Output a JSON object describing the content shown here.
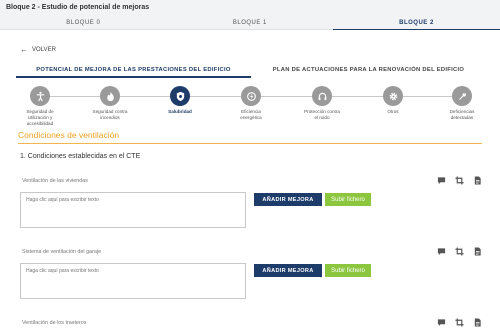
{
  "header": {
    "title": "Bloque 2 - Estudio de potencial de mejoras",
    "bloques": [
      "BLOQUE 0",
      "BLOQUE 1",
      "BLOQUE 2"
    ]
  },
  "back_label": "VOLVER",
  "section_tabs": [
    "POTENCIAL DE MEJORA DE LAS PRESTACIONES DEL EDIFICIO",
    "PLAN DE ACTUACIONES PARA LA RENOVACIÓN DEL EDIFICIO"
  ],
  "categories": [
    {
      "label_1": "Seguridad de",
      "label_2": "Utilización y",
      "label_3": "accesibilidad",
      "icon": "accessibility-icon"
    },
    {
      "label_1": "Seguridad contra",
      "label_2": "incendios",
      "label_3": "",
      "icon": "fire-icon"
    },
    {
      "label_1": "Salubridad",
      "label_2": "",
      "label_3": "",
      "icon": "shield-icon"
    },
    {
      "label_1": "Eficiencia",
      "label_2": "energética",
      "label_3": "",
      "icon": "energy-icon"
    },
    {
      "label_1": "Protección contra",
      "label_2": "el ruido",
      "label_3": "",
      "icon": "headphones-icon"
    },
    {
      "label_1": "Otros",
      "label_2": "",
      "label_3": "",
      "icon": "gear-icon"
    },
    {
      "label_1": "Deficiencias",
      "label_2": "detectadas",
      "label_3": "",
      "icon": "wrench-icon"
    }
  ],
  "colors": {
    "primary": "#1d3c6a",
    "accent": "#f0a024",
    "success": "#8cc63f"
  },
  "section_title": "Condiciones de ventilación",
  "subsection_title": "1. Condiciones establecidas en el CTE",
  "fields": [
    {
      "label": "Ventilación de las viviendas",
      "placeholder": "Haga clic aquí para escribir texto",
      "value": ""
    },
    {
      "label": "Sistema de ventilación del garaje",
      "placeholder": "Haga clic aquí para escribir texto",
      "value": ""
    },
    {
      "label": "Ventilación de los trasteros",
      "placeholder": "Haga clic aquí para escribir texto",
      "value": ""
    }
  ],
  "buttons": {
    "add_improvement": "AÑADIR MEJORA",
    "upload_file": "Subir fichero"
  }
}
